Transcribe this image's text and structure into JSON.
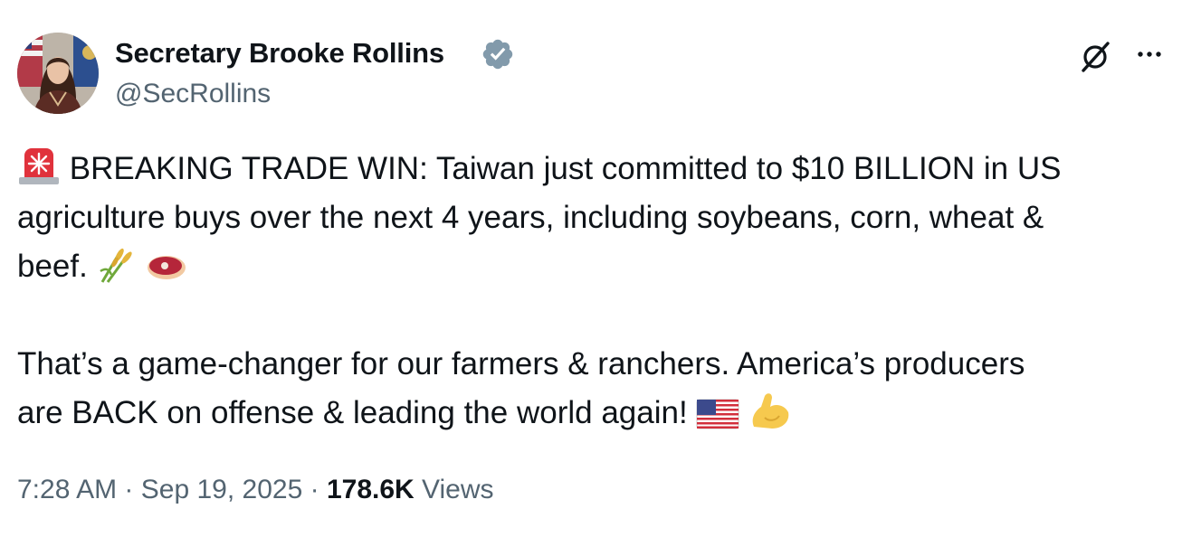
{
  "author": {
    "display_name": "Secretary Brooke Rollins",
    "handle": "@SecRollins",
    "verified": true,
    "verified_color": "#829aab"
  },
  "header_actions": {
    "grok_icon": "grok-slash-circle-icon",
    "more_icon": "more-horizontal-icon"
  },
  "post": {
    "lines": [
      "BREAKING TRADE WIN: Taiwan just committed to $10 BILLION in US",
      "agriculture buys over the next 4 years, including soybeans, corn, wheat &",
      "beef.",
      "That’s a game-changer for our farmers & ranchers. America’s producers",
      "are BACK on offense & leading the world again!"
    ],
    "emojis": {
      "siren": "police-light-emoji",
      "grain": "sheaf-of-rice-emoji",
      "meat": "cut-of-meat-emoji",
      "flag": "us-flag-emoji",
      "muscle": "flexed-biceps-emoji"
    }
  },
  "meta": {
    "time": "7:28 AM",
    "separator": "·",
    "date": "Sep 19, 2025",
    "views_count": "178.6K",
    "views_label": "Views"
  },
  "colors": {
    "text_primary": "#0f1419",
    "text_secondary": "#536471"
  }
}
